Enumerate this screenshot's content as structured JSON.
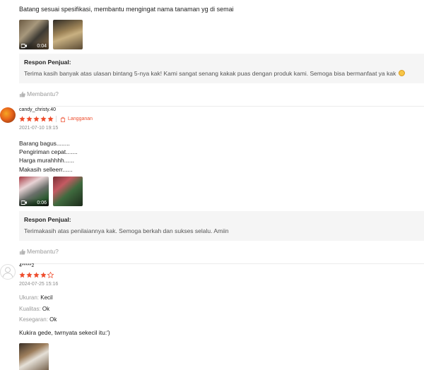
{
  "review_prev": {
    "text": "Batang sesuai spesifikasi, membantu mengingat nama tanaman yg di semai",
    "media": [
      {
        "type": "video",
        "duration": "0:04"
      },
      {
        "type": "image"
      }
    ],
    "seller_response": {
      "title": "Respon Penjual:",
      "text": "Terima kasih banyak atas ulasan bintang 5-nya kak! Kami sangat senang kakak puas dengan produk kami. Semoga bisa bermanfaat ya kak"
    },
    "helpful_label": "Membantu?"
  },
  "review_1": {
    "username": "candy_christy.40",
    "rating": 5,
    "badge": "Langganan",
    "date": "2021-07-10 19:15",
    "lines": [
      "Barang bagus........",
      "Pengiriman cepat.......",
      "Harga murahhhh......",
      "Makasih selleerr......"
    ],
    "media": [
      {
        "type": "video",
        "duration": "0:06"
      },
      {
        "type": "image"
      }
    ],
    "seller_response": {
      "title": "Respon Penjual:",
      "text": "Terimakasih atas penilaiannya kak. Semoga berkah dan sukses selalu. Amiin"
    },
    "helpful_label": "Membantu?"
  },
  "review_2": {
    "username": "4*****2",
    "rating": 4,
    "date": "2024-07-25 15:16",
    "attributes": [
      {
        "key": "Ukuran:",
        "value": "Kecil"
      },
      {
        "key": "Kualitas:",
        "value": "Ok"
      },
      {
        "key": "Kesegaran:",
        "value": "Ok"
      }
    ],
    "comment": "Kukira gede, twrnyata sekecil itu:')"
  },
  "colors": {
    "star": "#ee4d2d",
    "accent": "#ee4d2d",
    "response_bg": "#f5f5f5",
    "muted": "#9a9a9a"
  },
  "icons": [
    "video-camera-icon",
    "thumbs-up-icon",
    "star-icon",
    "shopping-bag-icon",
    "user-avatar-icon",
    "smile-emoji-icon"
  ]
}
